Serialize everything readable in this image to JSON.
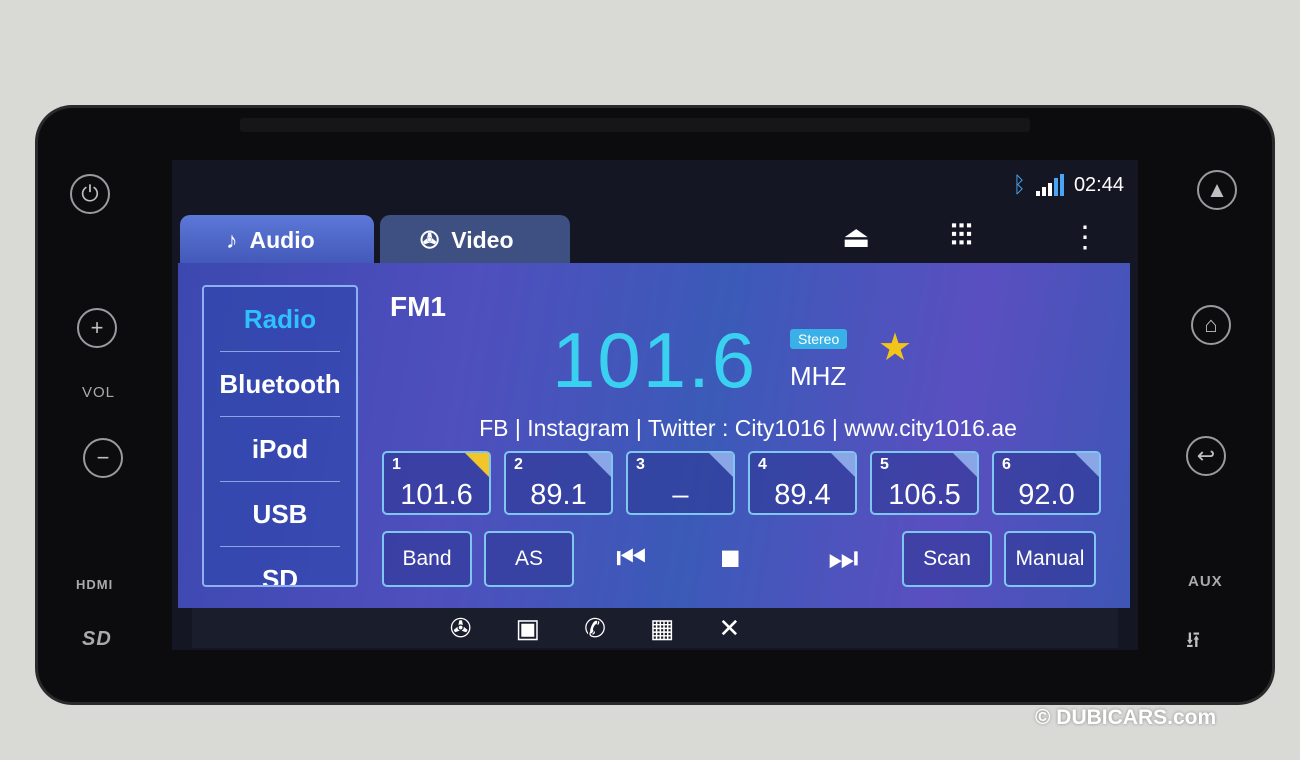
{
  "hardware": {
    "left": {
      "power": "power-icon",
      "plus": "+",
      "vol_label": "VOL",
      "minus": "−",
      "hdmi_label": "HDMI",
      "sd_label": "SD"
    },
    "right": {
      "nav": "navigation-icon",
      "home": "home-icon",
      "back": "back-icon",
      "aux_label": "AUX",
      "usb": "usb-icon"
    }
  },
  "status": {
    "time": "02:44",
    "bluetooth_icon": "bluetooth-icon",
    "signal_icon": "signal-icon"
  },
  "tabs": [
    {
      "label": "Audio",
      "icon": "music-note-icon",
      "active": true
    },
    {
      "label": "Video",
      "icon": "film-reel-icon",
      "active": false
    }
  ],
  "toolbar": {
    "eject": "eject-icon",
    "equalizer": "equalizer-icon",
    "menu": "menu-icon"
  },
  "sources": [
    {
      "label": "Radio",
      "selected": true
    },
    {
      "label": "Bluetooth"
    },
    {
      "label": "iPod"
    },
    {
      "label": "USB"
    },
    {
      "label": "SD"
    }
  ],
  "tuner": {
    "band": "FM1",
    "frequency": "101.6",
    "stereo": "Stereo",
    "unit": "MHZ",
    "favorite": true,
    "radio_text": "FB | Instagram | Twitter : City1016 | www.city1016.ae"
  },
  "presets": [
    {
      "n": "1",
      "f": "101.6",
      "active": true
    },
    {
      "n": "2",
      "f": "89.1"
    },
    {
      "n": "3",
      "f": "–"
    },
    {
      "n": "4",
      "f": "89.4"
    },
    {
      "n": "5",
      "f": "106.5"
    },
    {
      "n": "6",
      "f": "92.0"
    }
  ],
  "controls": {
    "band": "Band",
    "as": "AS",
    "scan": "Scan",
    "manual": "Manual"
  },
  "bottom_bar": [
    "media-icon",
    "map-icon",
    "phone-icon",
    "apps-icon",
    "settings-icon"
  ],
  "colors": {
    "accent": "#3ad0f0",
    "selected_source": "#2ec0ff",
    "favorite": "#f3c419"
  },
  "watermark": "© DUBICARS.com"
}
